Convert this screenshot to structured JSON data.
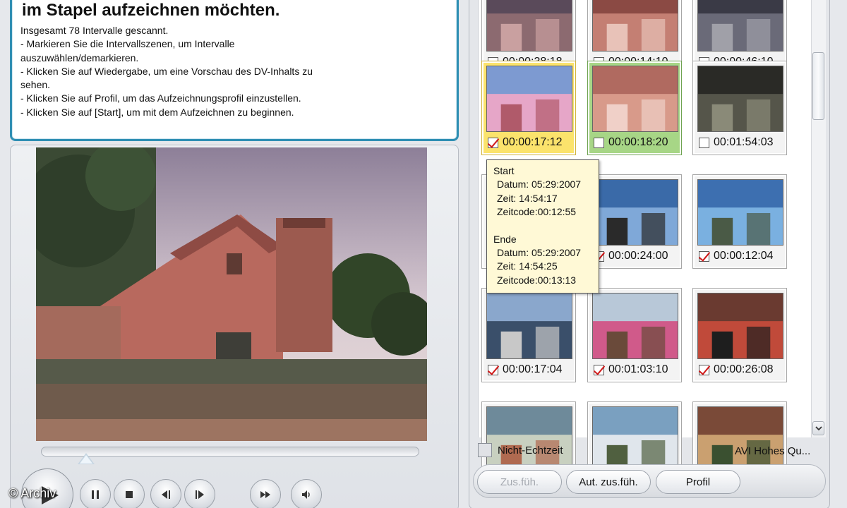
{
  "instructions": {
    "title": "im Stapel aufzeichnen möchten.",
    "lines": [
      "Insgesamt 78 Intervalle gescannt.",
      "- Markieren Sie die Intervallszenen, um Intervalle",
      "auszuwählen/demarkieren.",
      "- Klicken Sie auf Wiedergabe, um eine Vorschau des DV-Inhalts zu",
      "sehen.",
      "- Klicken Sie auf Profil, um das Aufzeichnungsprofil einzustellen.",
      "- Klicken Sie auf [Start], um mit dem Aufzeichnen zu beginnen."
    ]
  },
  "player": {
    "seek_position": 0.12,
    "watermark": "© Archiv",
    "controls": [
      "play-icon",
      "pause-icon",
      "stop-icon",
      "previous-frame-icon",
      "next-frame-icon",
      "fast-forward-icon",
      "volume-icon"
    ]
  },
  "thumbnails": [
    {
      "timecode": "00:00:38:18",
      "checked": false,
      "state": "normal"
    },
    {
      "timecode": "00:00:14:10",
      "checked": false,
      "state": "normal"
    },
    {
      "timecode": "00:00:46:10",
      "checked": false,
      "state": "normal"
    },
    {
      "timecode": "00:00:17:12",
      "checked": true,
      "state": "selected"
    },
    {
      "timecode": "00:00:18:20",
      "checked": false,
      "state": "hover"
    },
    {
      "timecode": "00:01:54:03",
      "checked": false,
      "state": "normal"
    },
    {
      "timecode": "",
      "checked": false,
      "state": "normal"
    },
    {
      "timecode": "00:00:24:00",
      "checked": true,
      "state": "normal"
    },
    {
      "timecode": "00:00:12:04",
      "checked": true,
      "state": "normal"
    },
    {
      "timecode": "00:00:17:04",
      "checked": true,
      "state": "normal"
    },
    {
      "timecode": "00:01:03:10",
      "checked": true,
      "state": "normal"
    },
    {
      "timecode": "00:00:26:08",
      "checked": true,
      "state": "normal"
    },
    {
      "timecode": "",
      "checked": false,
      "state": "normal"
    },
    {
      "timecode": "",
      "checked": false,
      "state": "normal"
    },
    {
      "timecode": "",
      "checked": false,
      "state": "normal"
    }
  ],
  "tooltip": {
    "start_label": "Start",
    "start_datum": "Datum: 05:29:2007",
    "start_zeit": "Zeit: 14:54:17",
    "start_zeitcode": "Zeitcode:00:12:55",
    "end_label": "Ende",
    "end_datum": "Datum: 05:29:2007",
    "end_zeit": "Zeit: 14:54:25",
    "end_zeitcode": "Zeitcode:00:13:13"
  },
  "options": {
    "non_realtime_label": "Nicht-Echtzeit",
    "non_realtime_checked": false,
    "profile_name": "AVI Hohes Qu..."
  },
  "buttons": {
    "merge_label": "Zus.füh.",
    "auto_merge_label": "Aut. zus.füh.",
    "profile_label": "Profil"
  }
}
